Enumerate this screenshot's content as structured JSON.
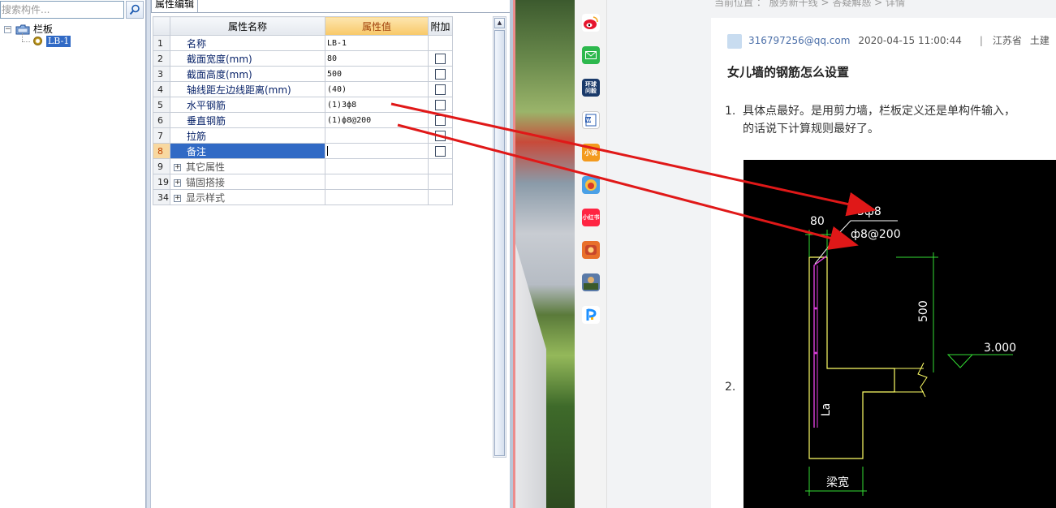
{
  "tree_panel": {
    "search_placeholder": "搜索构件...",
    "root_label": "栏板",
    "selected_item": "LB-1"
  },
  "property_panel": {
    "tab_label": "属性编辑",
    "headers": {
      "num": "",
      "name": "属性名称",
      "value": "属性值",
      "extra": "附加"
    },
    "rows": [
      {
        "num": "1",
        "name": "名称",
        "value": "LB-1",
        "checkbox": false
      },
      {
        "num": "2",
        "name": "截面宽度(mm)",
        "value": "80",
        "checkbox": true
      },
      {
        "num": "3",
        "name": "截面高度(mm)",
        "value": "500",
        "checkbox": true
      },
      {
        "num": "4",
        "name": "轴线距左边线距离(mm)",
        "value": "(40)",
        "checkbox": true
      },
      {
        "num": "5",
        "name": "水平钢筋",
        "value": "(1)3ф8",
        "checkbox": true
      },
      {
        "num": "6",
        "name": "垂直钢筋",
        "value": "(1)ф8@200",
        "checkbox": true
      },
      {
        "num": "7",
        "name": "拉筋",
        "value": "",
        "checkbox": true
      },
      {
        "num": "8",
        "name": "备注",
        "value": "",
        "checkbox": true
      },
      {
        "num": "9",
        "name": "其它属性",
        "value": "",
        "checkbox": false
      },
      {
        "num": "19",
        "name": "锚固搭接",
        "value": "",
        "checkbox": false
      },
      {
        "num": "34",
        "name": "显示样式",
        "value": "",
        "checkbox": false
      }
    ]
  },
  "dock": {
    "apps": [
      "weibo-icon",
      "mail-icon",
      "globe-qa-icon",
      "word-icon",
      "novel-icon",
      "game-icon",
      "xiaohongshu-icon",
      "game2-icon",
      "game3-icon",
      "pdf-icon"
    ],
    "labels": {
      "globe": "环球\n问毅",
      "novel": "小说",
      "xhs": "小红书"
    }
  },
  "article": {
    "breadcrumb": "当前位置 ：  服务新干线  >  答疑解惑  >  详情",
    "email": "316797256@qq.com",
    "datetime": "2020-04-15 11:00:44",
    "region": "江苏省",
    "specialty": "土建",
    "title": "女儿墙的钢筋怎么设置",
    "answer1_num": "1.",
    "answer1_line1": "具体点最好。是用剪力墙，栏板定义还是单构件输入，",
    "answer1_line2": "的话说下计算规则最好了。",
    "answer2_num": "2."
  },
  "cad_drawing": {
    "label_top_rebar": "3ф8",
    "label_width": "80",
    "label_vertical_rebar": "ф8@200",
    "label_height": "500",
    "label_level": "3.000",
    "label_la": "La",
    "label_beam_width": "梁宽"
  },
  "colors": {
    "selection": "#316ac5",
    "annotation_arrow": "#e01818",
    "cad_line": "#ffff66",
    "cad_dim": "#33dd33"
  }
}
